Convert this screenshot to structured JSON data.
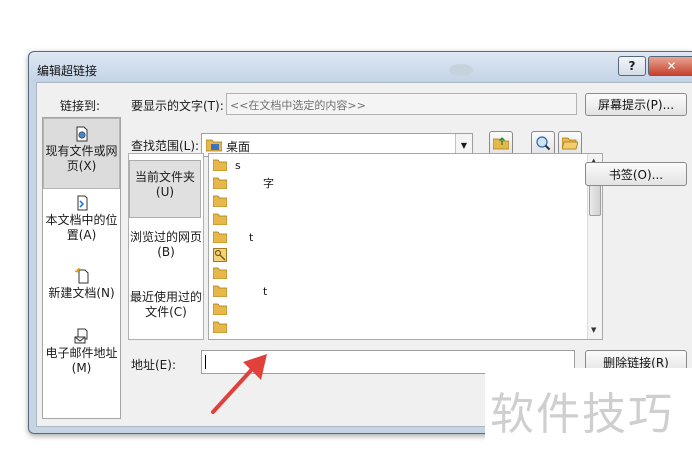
{
  "window": {
    "title": "编辑超链接",
    "help_label": "?",
    "close_label": "✕"
  },
  "link_to": {
    "label": "链接到:",
    "items": [
      {
        "label": "现有文件或网页(X)",
        "icon": "existing-file-icon",
        "selected": true
      },
      {
        "label": "本文档中的位置(A)",
        "icon": "place-in-document-icon",
        "selected": false
      },
      {
        "label": "新建文档(N)",
        "icon": "new-document-icon",
        "selected": false
      },
      {
        "label": "电子邮件地址(M)",
        "icon": "email-address-icon",
        "selected": false
      }
    ]
  },
  "display_text": {
    "label": "要显示的文字(T):",
    "value": "<<在文档中选定的内容>>"
  },
  "screen_tip_label": "屏幕提示(P)...",
  "look_in": {
    "label": "查找范围(L):",
    "value": "桌面"
  },
  "places": [
    {
      "label": "当前文件夹(U)",
      "selected": true
    },
    {
      "label": "浏览过的网页(B)",
      "selected": false
    },
    {
      "label": "最近使用过的文件(C)",
      "selected": false
    }
  ],
  "bookmark_label": "书签(O)...",
  "files": [
    {
      "icon": "folder-icon",
      "name": "s"
    },
    {
      "icon": "folder-icon",
      "name": "字"
    },
    {
      "icon": "folder-icon",
      "name": ""
    },
    {
      "icon": "folder-icon",
      "name": ""
    },
    {
      "icon": "folder-icon",
      "name": "t"
    },
    {
      "icon": "shortcut-icon",
      "name": ""
    },
    {
      "icon": "folder-icon",
      "name": ""
    },
    {
      "icon": "folder-icon",
      "name": "t"
    },
    {
      "icon": "folder-icon",
      "name": ""
    },
    {
      "icon": "folder-icon",
      "name": ""
    }
  ],
  "address": {
    "label": "地址(E):",
    "value": ""
  },
  "remove_link_label": "删除链接(R)",
  "watermark": "软件技巧",
  "colors": {
    "arrow": "#e0413a",
    "folder": "#e8b74a"
  }
}
